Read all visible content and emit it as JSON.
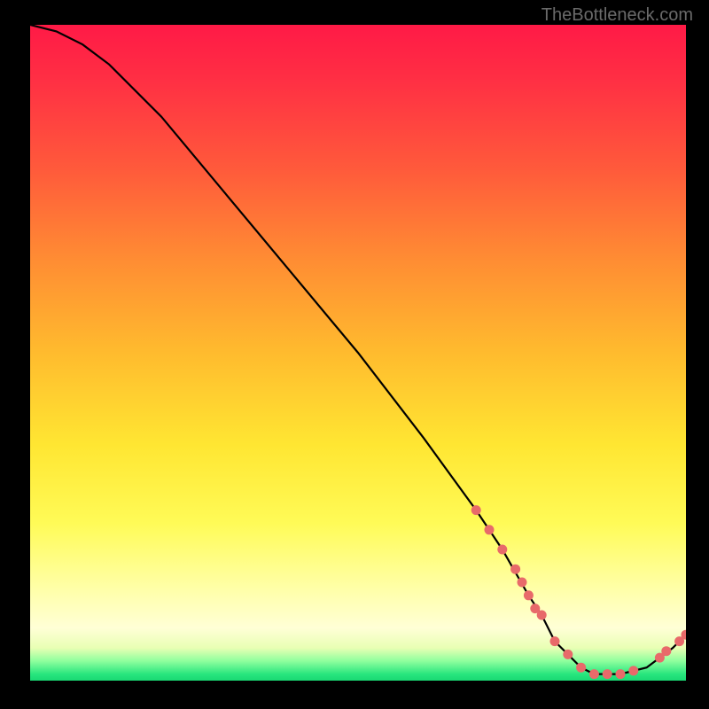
{
  "watermark": "TheBottleneck.com",
  "chart_data": {
    "type": "line",
    "title": "",
    "xlabel": "",
    "ylabel": "",
    "xlim": [
      0,
      100
    ],
    "ylim": [
      0,
      100
    ],
    "grid": false,
    "series": [
      {
        "name": "curve",
        "x": [
          0,
          4,
          8,
          12,
          20,
          30,
          40,
          50,
          60,
          68,
          72,
          76,
          78,
          80,
          82,
          84,
          86,
          90,
          94,
          98,
          100
        ],
        "y": [
          100,
          99,
          97,
          94,
          86,
          74,
          62,
          50,
          37,
          26,
          20,
          13,
          10,
          6,
          4,
          2,
          1,
          1,
          2,
          5,
          7
        ]
      }
    ],
    "markers": [
      {
        "name": "dot",
        "series": "curve",
        "x": 68,
        "y": 26
      },
      {
        "name": "dot",
        "series": "curve",
        "x": 70,
        "y": 23
      },
      {
        "name": "dot",
        "series": "curve",
        "x": 72,
        "y": 20
      },
      {
        "name": "dot",
        "series": "curve",
        "x": 74,
        "y": 17
      },
      {
        "name": "dot",
        "series": "curve",
        "x": 75,
        "y": 15
      },
      {
        "name": "dot",
        "series": "curve",
        "x": 76,
        "y": 13
      },
      {
        "name": "dot",
        "series": "curve",
        "x": 77,
        "y": 11
      },
      {
        "name": "dot",
        "series": "curve",
        "x": 78,
        "y": 10
      },
      {
        "name": "dot",
        "series": "curve",
        "x": 80,
        "y": 6
      },
      {
        "name": "dot",
        "series": "curve",
        "x": 82,
        "y": 4
      },
      {
        "name": "dot",
        "series": "curve",
        "x": 84,
        "y": 2
      },
      {
        "name": "dot",
        "series": "curve",
        "x": 86,
        "y": 1
      },
      {
        "name": "dot",
        "series": "curve",
        "x": 88,
        "y": 1
      },
      {
        "name": "dot",
        "series": "curve",
        "x": 90,
        "y": 1
      },
      {
        "name": "dot",
        "series": "curve",
        "x": 92,
        "y": 1.5
      },
      {
        "name": "dot",
        "series": "curve",
        "x": 96,
        "y": 3.5
      },
      {
        "name": "dot",
        "series": "curve",
        "x": 97,
        "y": 4.5
      },
      {
        "name": "dot",
        "series": "curve",
        "x": 99,
        "y": 6
      },
      {
        "name": "dot",
        "series": "curve",
        "x": 100,
        "y": 7
      }
    ],
    "colors": {
      "curve": "#000000",
      "markers": "#e86a6a",
      "gradient_top": "#ff1a46",
      "gradient_mid": "#ffe632",
      "gradient_bottom": "#19d873"
    }
  }
}
